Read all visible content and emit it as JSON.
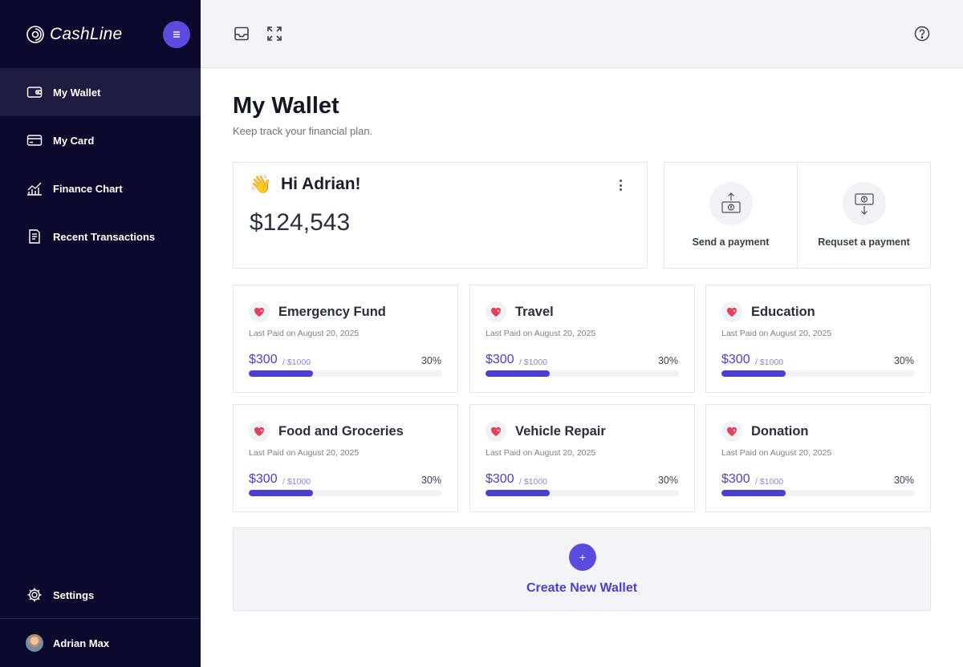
{
  "app": {
    "brand": "CashLine"
  },
  "sidebar": {
    "items": [
      {
        "label": "My Wallet",
        "icon": "wallet-icon",
        "active": true
      },
      {
        "label": "My Card",
        "icon": "card-icon"
      },
      {
        "label": "Finance Chart",
        "icon": "chart-icon"
      },
      {
        "label": "Recent Transactions",
        "icon": "receipt-icon"
      }
    ],
    "settings": {
      "label": "Settings",
      "icon": "gear-icon"
    },
    "user": {
      "name": "Adrian Max"
    }
  },
  "topbar": {
    "icons": [
      "inbox-icon",
      "expand-icon",
      "help-icon"
    ]
  },
  "page": {
    "title": "My Wallet",
    "subtitle": "Keep track your financial plan."
  },
  "balance_card": {
    "greeting": "Hi Adrian!",
    "emoji": "👋",
    "balance": "$124,543"
  },
  "payments": [
    {
      "label": "Send a payment",
      "icon": "send-money-icon"
    },
    {
      "label": "Requset a payment",
      "icon": "request-money-icon"
    }
  ],
  "wallets": [
    {
      "name": "Emergency Fund",
      "date": "Last Paid on August 20, 2025",
      "amount": "$300",
      "goal": "/ $1000",
      "percent": "30%",
      "progress": 0.33
    },
    {
      "name": "Travel",
      "date": "Last Paid on August 20, 2025",
      "amount": "$300",
      "goal": "/ $1000",
      "percent": "30%",
      "progress": 0.33
    },
    {
      "name": "Education",
      "date": "Last Paid on August 20, 2025",
      "amount": "$300",
      "goal": "/ $1000",
      "percent": "30%",
      "progress": 0.33
    },
    {
      "name": "Food and Groceries",
      "date": "Last Paid on August 20, 2025",
      "amount": "$300",
      "goal": "/ $1000",
      "percent": "30%",
      "progress": 0.33
    },
    {
      "name": "Vehicle Repair",
      "date": "Last Paid on August 20, 2025",
      "amount": "$300",
      "goal": "/ $1000",
      "percent": "30%",
      "progress": 0.33
    },
    {
      "name": "Donation",
      "date": "Last Paid on August 20, 2025",
      "amount": "$300",
      "goal": "/ $1000",
      "percent": "30%",
      "progress": 0.33
    }
  ],
  "create_wallet": {
    "label": "Create New Wallet",
    "plus": "+"
  },
  "colors": {
    "sidebar_bg": "#0b0a2c",
    "accent": "#5b4ce0",
    "progress": "#4a3fd0",
    "topbar_bg": "#f3f4f8"
  }
}
